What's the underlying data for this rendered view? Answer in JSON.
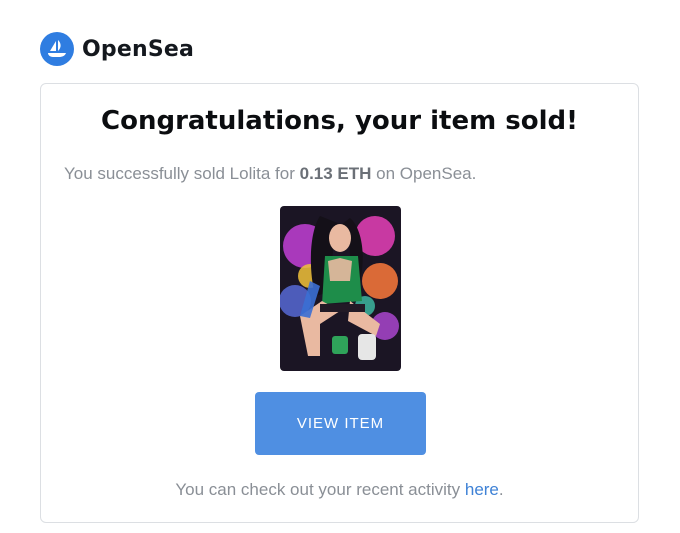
{
  "header": {
    "brand": "OpenSea",
    "logo_icon": "opensea-boat-icon"
  },
  "card": {
    "title": "Congratulations, your item sold!",
    "subtitle": {
      "prefix": "You successfully sold Lolita for ",
      "amount": "0.13 ETH",
      "suffix": " on OpenSea."
    },
    "nft_image_icon": "nft-artwork-image",
    "button_label": "VIEW ITEM",
    "footer": {
      "prefix": "You can check out your recent activity ",
      "link": "here",
      "suffix": "."
    }
  },
  "colors": {
    "brand_blue": "#2f7de1",
    "button_blue": "#4f8fe2",
    "link_blue": "#3f82d6"
  }
}
